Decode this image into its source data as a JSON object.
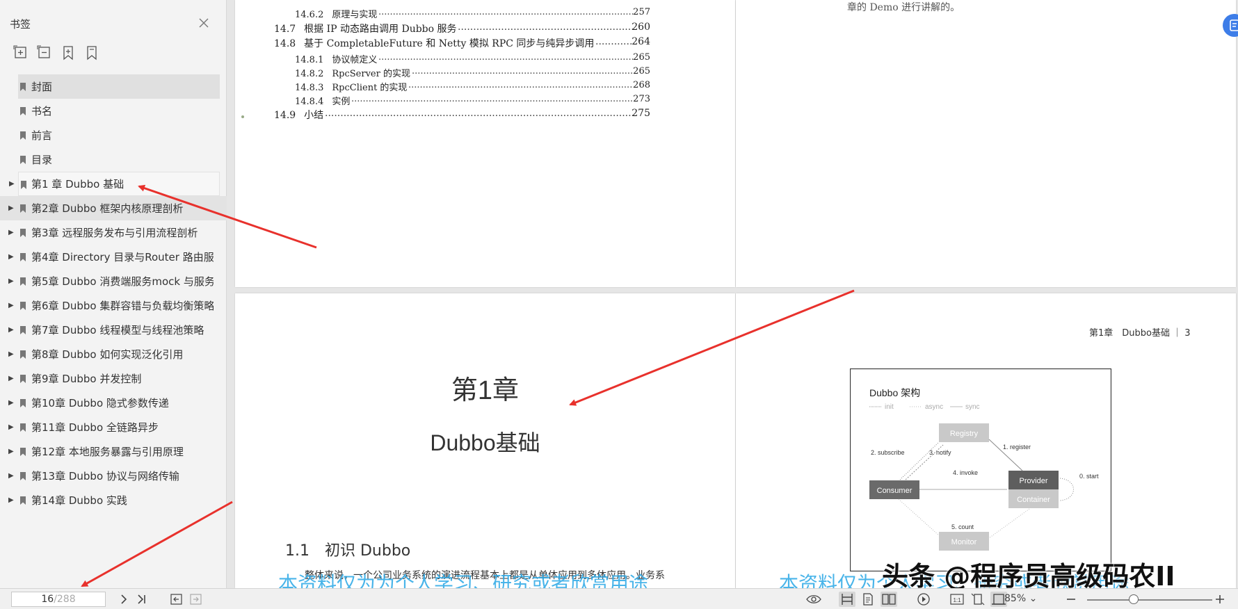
{
  "sidebar": {
    "title": "书签",
    "bookmarks": [
      {
        "label": "封面",
        "expandable": false
      },
      {
        "label": "书名",
        "expandable": false
      },
      {
        "label": "前言",
        "expandable": false
      },
      {
        "label": "目录",
        "expandable": false
      },
      {
        "label": "第1 章 Dubbo 基础",
        "expandable": true
      },
      {
        "label": "第2章 Dubbo 框架内核原理剖析",
        "expandable": true
      },
      {
        "label": "第3章 远程服务发布与引用流程剖析",
        "expandable": true
      },
      {
        "label": "第4章 Directory 目录与Router 路由服",
        "expandable": true
      },
      {
        "label": "第5章 Dubbo 消费端服务mock 与服务",
        "expandable": true
      },
      {
        "label": "第6章 Dubbo 集群容错与负载均衡策略",
        "expandable": true
      },
      {
        "label": "第7章 Dubbo 线程模型与线程池策略",
        "expandable": true
      },
      {
        "label": "第8章 Dubbo 如何实现泛化引用",
        "expandable": true
      },
      {
        "label": "第9章 Dubbo 并发控制",
        "expandable": true
      },
      {
        "label": "第10章 Dubbo 隐式参数传递",
        "expandable": true
      },
      {
        "label": "第11章 Dubbo 全链路异步",
        "expandable": true
      },
      {
        "label": "第12章 本地服务暴露与引用原理",
        "expandable": true
      },
      {
        "label": "第13章 Dubbo 协议与网络传输",
        "expandable": true
      },
      {
        "label": "第14章 Dubbo 实践",
        "expandable": true
      }
    ]
  },
  "toc": [
    {
      "num": "14.6.2",
      "title": "原理与实现",
      "page": "257",
      "level": 2
    },
    {
      "num": "14.7",
      "title": "根据 IP 动态路由调用 Dubbo 服务",
      "page": "260",
      "level": 1
    },
    {
      "num": "14.8",
      "title": "基于 CompletableFuture 和 Netty 模拟 RPC 同步与纯异步调用",
      "page": "264",
      "level": 1
    },
    {
      "num": "14.8.1",
      "title": "协议帧定义",
      "page": "265",
      "level": 2
    },
    {
      "num": "14.8.2",
      "title": "RpcServer 的实现",
      "page": "265",
      "level": 2
    },
    {
      "num": "14.8.3",
      "title": "RpcClient 的实现",
      "page": "268",
      "level": 2
    },
    {
      "num": "14.8.4",
      "title": "实例",
      "page": "273",
      "level": 2
    },
    {
      "num": "14.9",
      "title": "小结",
      "page": "275",
      "level": 1
    }
  ],
  "right_top_text": "章的 Demo 进行讲解的。",
  "chapter_page": {
    "chapter_num": "第1章",
    "chapter_title": "Dubbo基础",
    "section_num": "1.1",
    "section_title": "初识 Dubbo",
    "body_start": "整体来说，一个公司业务系统的演进流程基本上都是从单体应用到多体应用。业务系"
  },
  "right_page": {
    "header": "第1章　Dubbo基础 ｜ 3",
    "diagram": {
      "title": "Dubbo 架构",
      "legend": [
        "init",
        "async",
        "sync"
      ],
      "nodes": [
        "Registry",
        "Provider",
        "Container",
        "Consumer",
        "Monitor"
      ],
      "labels": [
        "1. register",
        "2. subscribe",
        "3. notify",
        "4. invoke",
        "5. count",
        "0. start"
      ]
    }
  },
  "watermarks": {
    "left": "本资料仅为为个人学习、研究或者欣赏用途",
    "right": "本资料仅为个人学习、研究或者欣赏用途",
    "author": "头条 @程序员高级码农II"
  },
  "bottombar": {
    "current_page": "16",
    "total_pages": "/288",
    "zoom": "85%"
  }
}
